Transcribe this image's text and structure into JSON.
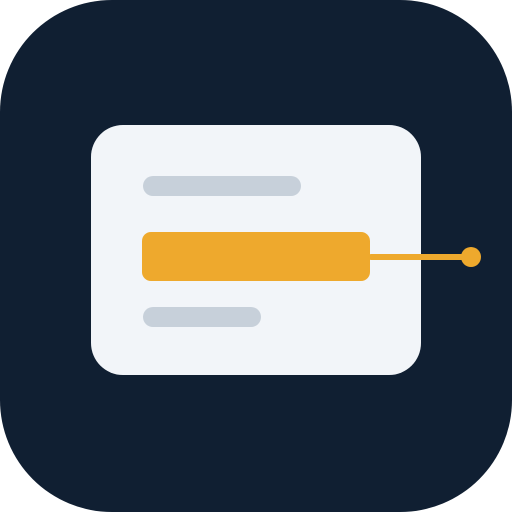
{
  "icon": {
    "name": "selected-text-line-app-icon",
    "colors": {
      "background": "#101f32",
      "card": "#f2f5f9",
      "placeholder": "#c7d0da",
      "accent": "#eea92d"
    }
  }
}
